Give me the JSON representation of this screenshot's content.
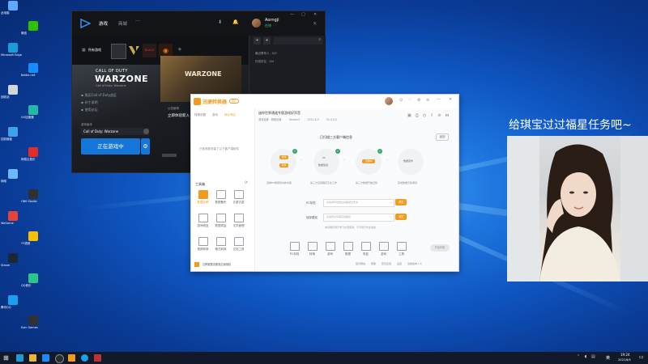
{
  "desktop": {
    "icons": [
      {
        "label": "此电脑"
      },
      {
        "label": "Microsoft Edge"
      },
      {
        "label": "回收站"
      },
      {
        "label": "控制面板"
      },
      {
        "label": "网络"
      },
      {
        "label": "WeGame"
      },
      {
        "label": "Steam"
      },
      {
        "label": "腾讯QQ"
      },
      {
        "label": "微信"
      },
      {
        "label": "Battle.net"
      },
      {
        "label": "UU加速器"
      },
      {
        "label": "网易云音乐"
      },
      {
        "label": "OBS Studio"
      },
      {
        "label": "YY语音"
      },
      {
        "label": "QQ音乐"
      },
      {
        "label": "Epic Games"
      }
    ]
  },
  "battlenet": {
    "nav_games": "游戏",
    "nav_shop": "商城",
    "more": "···",
    "username": "Aorngji",
    "status": "在线",
    "tab_all_games": "所有游戏",
    "game_title": "WARZONE",
    "game_brand": "CALL OF DUTY",
    "game_subtitle": "Call of Duty: Warzone",
    "menu_items": [
      "购买Call of Duty战区",
      "补丁说明",
      "使用论坛"
    ],
    "version_label": "游戏版本",
    "version_value": "Call of Duty: Warzone",
    "play_button": "正在游戏中",
    "news_label": "公告新闻",
    "news_title": "立即体验新入",
    "friends": [
      "最近联系人 - 0/0",
      "在线好友 - 0/4"
    ]
  },
  "tool": {
    "brand": "迅捷转换器",
    "badge": "VIP",
    "tabs": [
      "转换设置",
      "游戏",
      "特价专区"
    ],
    "file_name": "迷你世界通道专版游戏好声音",
    "file_meta": [
      "游戏设置 · 网络设置",
      "Version2",
      "2021-6-5",
      "V1.5.5.0"
    ],
    "step_title": "已扫描三方客户端信息",
    "steps": [
      {
        "caption": "选择PC端游戏中的内容",
        "btn1": "游戏",
        "btn2": "转换"
      },
      {
        "caption": "第三方应用程序正在工作",
        "btn1": "PC",
        "btn2": "数据加载"
      },
      {
        "caption": "第三方数据开始迁移",
        "btn1": "迁移中"
      },
      {
        "caption": "完成数据迁移游戏",
        "btn1": "数据完毕"
      }
    ],
    "left_note": "已检测到安装了以下客户端软件",
    "tools_title": "工具箱",
    "tools": [
      "数据迁移",
      "数据备份",
      "去重去重",
      "游戏修复",
      "数据恢复",
      "文件管理",
      "视频转换",
      "格式转换",
      "文档工具"
    ],
    "promo_text": "迁移数据请使用正版授权",
    "field1_label": "PC存档",
    "field1_placeholder": "请选择存档所在的路径文件夹",
    "field2_label": "保存路径",
    "field2_placeholder": "请选择文件保存的路径",
    "browse_label": "浏览",
    "hint": "本功能仅用于学习交流使用，不可用于商业用途",
    "close_label": "返回",
    "bottom_tabs": [
      "PC存档",
      "转换",
      "游戏",
      "数据",
      "恢复",
      "游戏",
      "工具"
    ],
    "start_btn": "开始转换",
    "footer_links": [
      "官方网站",
      "帮助",
      "意见反馈",
      "设置",
      "当前版本:1.5"
    ]
  },
  "stream_overlay": {
    "text": "给琪宝过过福星任务吧~"
  },
  "taskbar": {
    "time": "19:24",
    "date": "2021/6/5",
    "lang": "英"
  },
  "colors": {
    "accent_blue": "#1476d8",
    "tool_orange": "#f29b1d",
    "wallpaper": "#0f56c2"
  }
}
